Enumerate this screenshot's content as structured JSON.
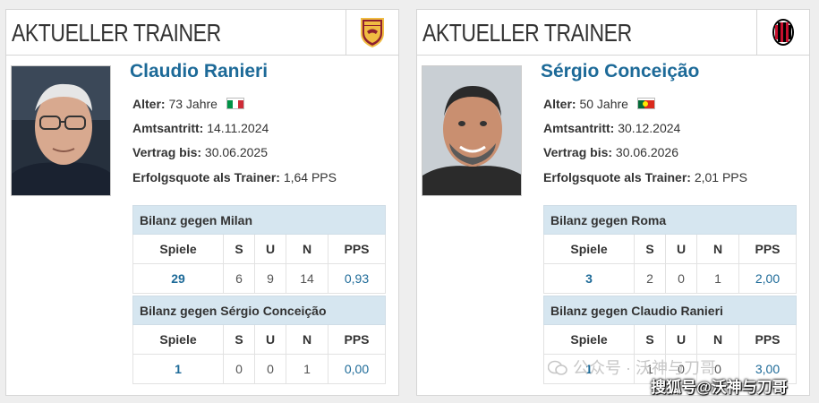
{
  "cards": [
    {
      "title": "AKTUELLER TRAINER",
      "crest": "as-roma-crest-icon",
      "name": "Claudio Ranieri",
      "age_label": "Alter:",
      "age_value": "73 Jahre",
      "nationality_flag": "italy-flag-icon",
      "since_label": "Amtsantritt:",
      "since_value": "14.11.2024",
      "contract_label": "Vertrag bis:",
      "contract_value": "30.06.2025",
      "ppg_label": "Erfolgsquote als Trainer:",
      "ppg_value": "1,64 PPS",
      "tables": [
        {
          "heading": "Bilanz gegen Milan",
          "columns": [
            "Spiele",
            "S",
            "U",
            "N",
            "PPS"
          ],
          "row": [
            "29",
            "6",
            "9",
            "14",
            "0,93"
          ]
        },
        {
          "heading": "Bilanz gegen Sérgio Conceição",
          "columns": [
            "Spiele",
            "S",
            "U",
            "N",
            "PPS"
          ],
          "row": [
            "1",
            "0",
            "0",
            "1",
            "0,00"
          ]
        }
      ]
    },
    {
      "title": "AKTUELLER TRAINER",
      "crest": "ac-milan-crest-icon",
      "name": "Sérgio Conceição",
      "age_label": "Alter:",
      "age_value": "50 Jahre",
      "nationality_flag": "portugal-flag-icon",
      "since_label": "Amtsantritt:",
      "since_value": "30.12.2024",
      "contract_label": "Vertrag bis:",
      "contract_value": "30.06.2026",
      "ppg_label": "Erfolgsquote als Trainer:",
      "ppg_value": "2,01 PPS",
      "tables": [
        {
          "heading": "Bilanz gegen Roma",
          "columns": [
            "Spiele",
            "S",
            "U",
            "N",
            "PPS"
          ],
          "row": [
            "3",
            "2",
            "0",
            "1",
            "2,00"
          ]
        },
        {
          "heading": "Bilanz gegen Claudio Ranieri",
          "columns": [
            "Spiele",
            "S",
            "U",
            "N",
            "PPS"
          ],
          "row": [
            "1",
            "1",
            "0",
            "0",
            "3,00"
          ]
        }
      ]
    }
  ],
  "watermark": {
    "line1": "公众号 · 沃神与刀哥",
    "line2": "搜狐号@沃神与刀哥"
  },
  "colors": {
    "link": "#1d6a98",
    "table_header_bg": "#d6e6f0",
    "page_bg": "#eeeeee"
  }
}
